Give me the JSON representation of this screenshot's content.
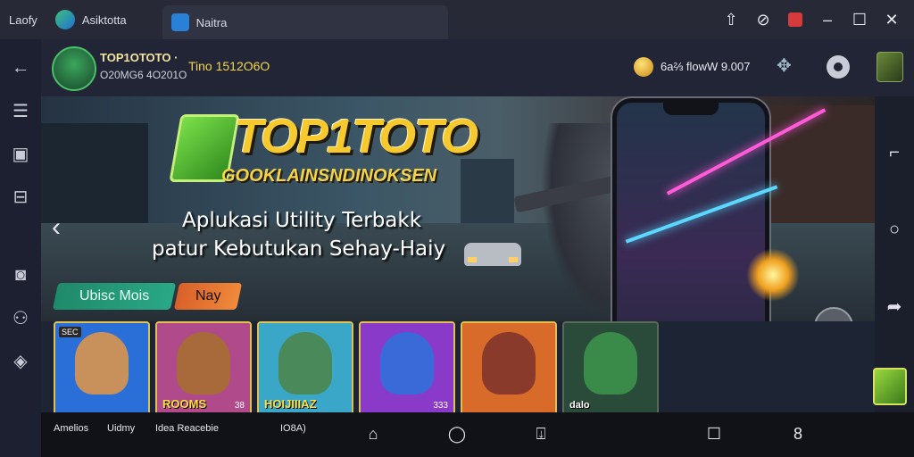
{
  "window": {
    "tabs": [
      {
        "label": "Laofy",
        "active": false
      },
      {
        "label": "Asiktotta",
        "active": true
      },
      {
        "label": "Naitra",
        "active": false
      }
    ],
    "controls": [
      "update-icon",
      "link-icon",
      "record-icon",
      "minimize-icon",
      "maximize-icon",
      "close-icon"
    ],
    "accent": "#d63a3a"
  },
  "header": {
    "title": "TOP1OTOTO ·",
    "subtitle": "O20MG6 4O201O",
    "time": "Tino  1512O6O",
    "balance_label": "6a⅔ flowW  9.007",
    "coin_color": "#f5c22e"
  },
  "sidebar": {
    "items": [
      "back-icon",
      "menu-icon",
      "screenshot-icon",
      "folder-icon",
      "camera-icon",
      "people-icon",
      "location-icon"
    ]
  },
  "rightbar": {
    "items": [
      "resize-icon",
      "circle-icon",
      "share-icon"
    ]
  },
  "banner": {
    "logo": "TOP1TOTO",
    "logo_sub": "GOOKLAINSNDINOKSEN",
    "tagline_line1": "Aplukasi Utility Terbakk",
    "tagline_line2": "patur Kebutukan Sehay-Haiy",
    "chip_primary": "Ubisc Mois",
    "chip_secondary": "Nay",
    "brand_color": "#f6c92e"
  },
  "cards": [
    {
      "tag": "SEC",
      "name": "",
      "num": "",
      "bg": "#2a6fd8",
      "face": "#c8905a"
    },
    {
      "tag": "",
      "name": "ROOMS",
      "num": "38",
      "bg": "#b04a8a",
      "face": "#a86a3a"
    },
    {
      "tag": "",
      "name": "HOIJIIIAZ",
      "num": "",
      "bg": "#3aa6c8",
      "face": "#4a8a5a"
    },
    {
      "tag": "",
      "name": "",
      "num": "333",
      "bg": "#8a3ac8",
      "face": "#3a6ad8"
    },
    {
      "tag": "",
      "name": "",
      "num": "",
      "bg": "#d86a2a",
      "face": "#8a3a2a"
    },
    {
      "tag": "",
      "name": "dalo",
      "num": "",
      "bg": "#2a4a3a",
      "face": "#3a8a4a"
    }
  ],
  "navbar": {
    "label1": "Amelios",
    "label2": "Uidmy",
    "label3": "Idea Reacebie",
    "label4": "IO8A)"
  }
}
